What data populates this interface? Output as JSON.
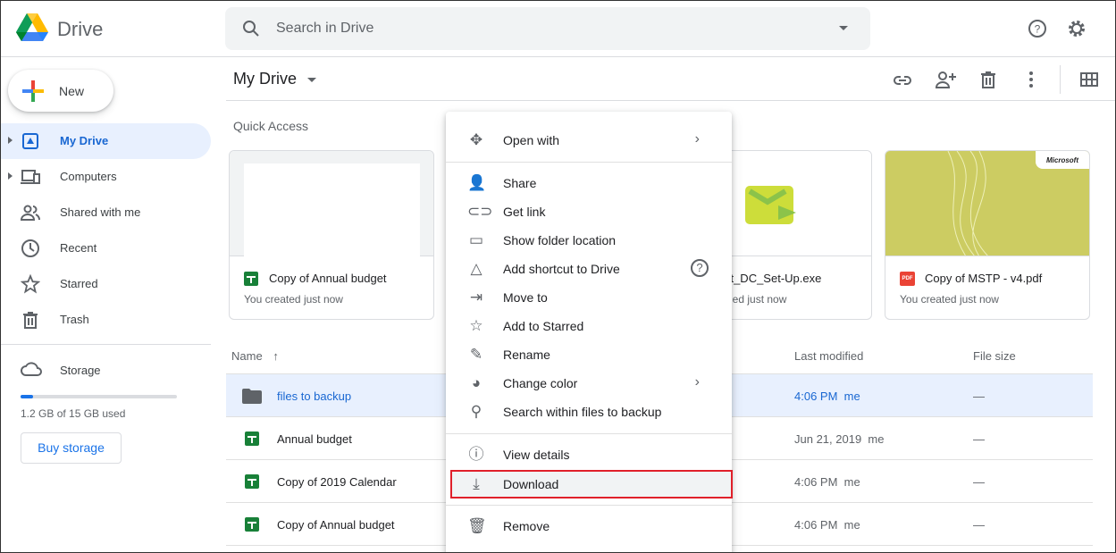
{
  "header": {
    "app_name": "Drive",
    "search_placeholder": "Search in Drive"
  },
  "sidebar": {
    "new_label": "New",
    "items": [
      {
        "label": "My Drive",
        "icon": "drive-icon",
        "active": true
      },
      {
        "label": "Computers",
        "icon": "computer-icon"
      },
      {
        "label": "Shared with me",
        "icon": "people-icon"
      },
      {
        "label": "Recent",
        "icon": "clock-icon"
      },
      {
        "label": "Starred",
        "icon": "star-icon"
      },
      {
        "label": "Trash",
        "icon": "trash-icon"
      }
    ],
    "storage_label": "Storage",
    "storage_used": "1.2 GB of 15 GB used",
    "storage_fraction": 0.08,
    "buy_storage": "Buy storage"
  },
  "main": {
    "title": "My Drive",
    "quick_access_label": "Quick Access",
    "cards": [
      {
        "name": "Copy of Annual budget",
        "sub": "You created just now",
        "type": "sheet"
      },
      {
        "name": "bat_DC_Set-Up.exe",
        "sub": "ded just now",
        "type": "exe"
      },
      {
        "name": "Copy of MSTP - v4.pdf",
        "sub": "You created just now",
        "type": "pdf",
        "thumb_text": "Microsoft"
      }
    ],
    "columns": {
      "name": "Name",
      "modified": "Last modified",
      "size": "File size"
    },
    "rows": [
      {
        "name": "files to backup",
        "modified": "4:06 PM",
        "owner": "me",
        "size": "—",
        "type": "folder",
        "selected": true
      },
      {
        "name": "Annual budget",
        "modified": "Jun 21, 2019",
        "owner": "me",
        "size": "—",
        "type": "sheet"
      },
      {
        "name": "Copy of 2019 Calendar",
        "modified": "4:06 PM",
        "owner": "me",
        "size": "—",
        "type": "sheet"
      },
      {
        "name": "Copy of Annual budget",
        "modified": "4:06 PM",
        "owner": "me",
        "size": "—",
        "type": "sheet"
      }
    ]
  },
  "context_menu": {
    "items": [
      {
        "label": "Open with"
      },
      {
        "label": "Share"
      },
      {
        "label": "Get link"
      },
      {
        "label": "Show folder location"
      },
      {
        "label": "Add shortcut to Drive"
      },
      {
        "label": "Move to"
      },
      {
        "label": "Add to Starred"
      },
      {
        "label": "Rename"
      },
      {
        "label": "Change color"
      },
      {
        "label": "Search within files to backup"
      },
      {
        "label": "View details"
      },
      {
        "label": "Download",
        "highlighted": true
      },
      {
        "label": "Remove"
      }
    ]
  },
  "colors": {
    "accent": "#1967d2",
    "selected_bg": "#e8f0fe",
    "highlight_border": "#e0202a"
  }
}
